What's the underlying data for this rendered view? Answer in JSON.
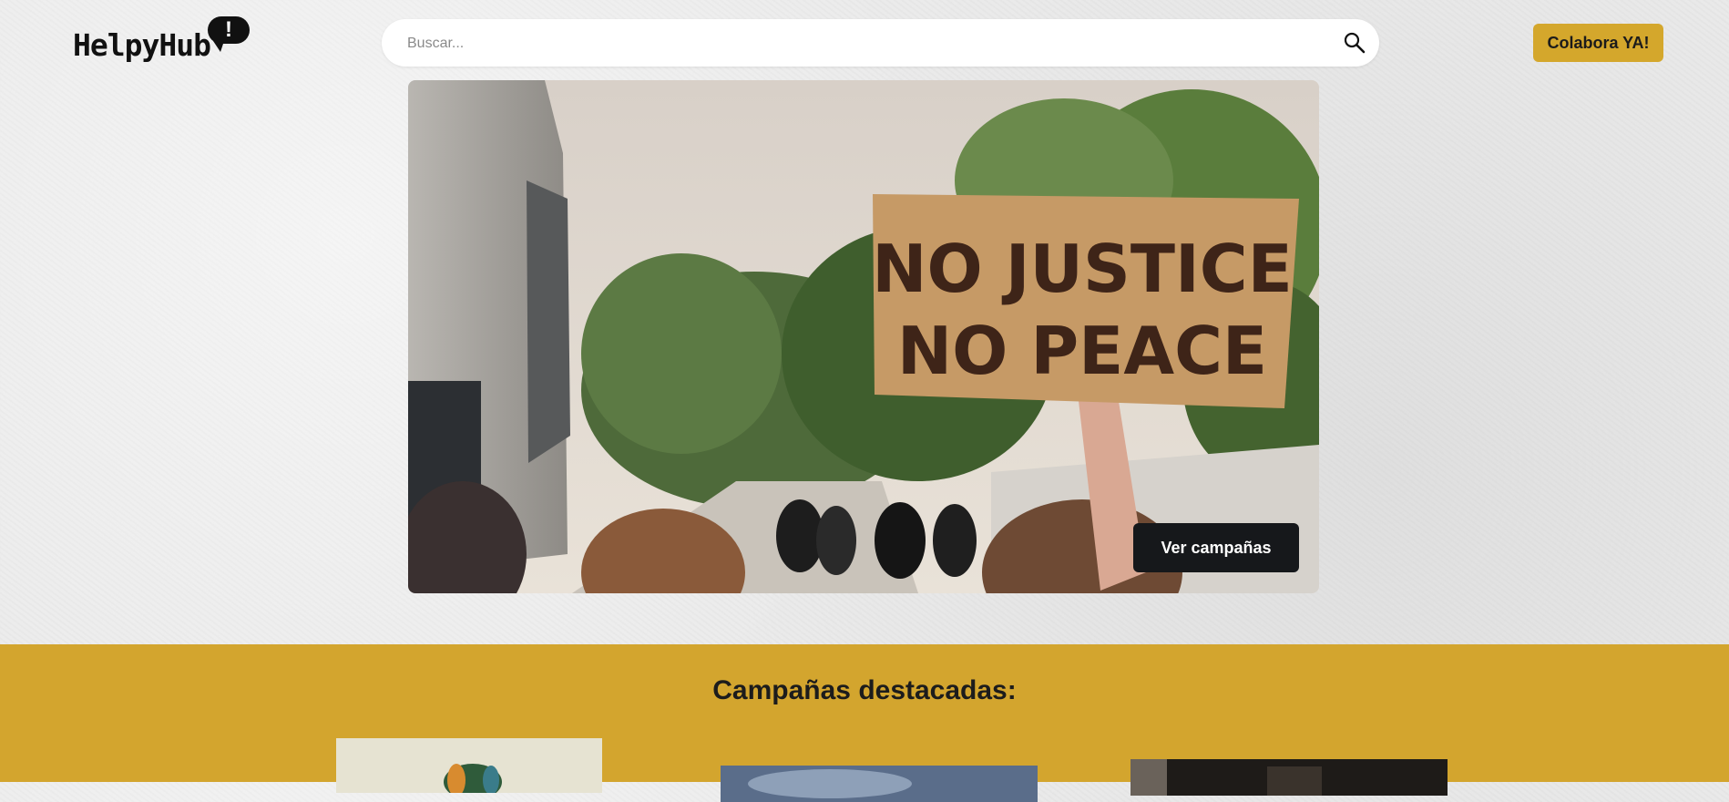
{
  "header": {
    "logo_text": "HelpyHub",
    "logo_mark": "!",
    "search": {
      "placeholder": "Buscar...",
      "icon": "search-icon"
    },
    "cta_label": "Colabora YA!"
  },
  "hero": {
    "sign_line1": "NO JUSTICE",
    "sign_line2": "NO PEACE",
    "button_label": "Ver campañas"
  },
  "featured": {
    "title": "Campañas destacadas:"
  },
  "colors": {
    "accent": "#d4a72c",
    "section_bg": "#d3a52e",
    "dark_button": "#16181b",
    "page_bg": "#ebebeb"
  }
}
